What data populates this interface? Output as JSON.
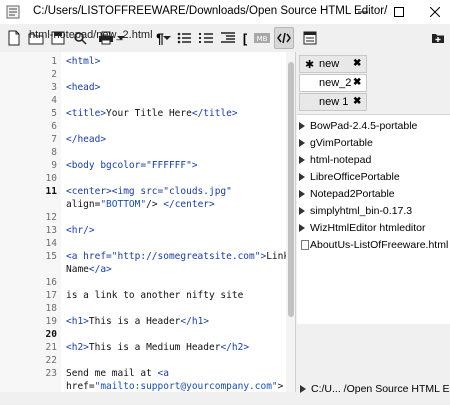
{
  "window": {
    "title": "C:/Users/LISTOFFREEWARE/Downloads/Open Source HTML Editor/"
  },
  "toolbar": {
    "tab_tooltip": "html-notepad/new_2.html",
    "icons": [
      "new-document-icon",
      "open-folder-icon",
      "save-icon",
      "find-icon",
      "print-icon",
      "dropdown-icon",
      "paragraph-icon",
      "dropdown-icon",
      "bullet-list-icon",
      "numbered-list-icon",
      "indent-icon",
      "outdent-icon",
      "bracket-icon",
      "highlight-icon",
      "code-view-icon",
      "layout-icon",
      "add-folder-icon"
    ]
  },
  "editor": {
    "lines": [
      {
        "n": "1",
        "text": "<html>"
      },
      {
        "n": "2",
        "text": ""
      },
      {
        "n": "3",
        "text": "<head>"
      },
      {
        "n": "4",
        "text": ""
      },
      {
        "n": "5",
        "text": "<title>Your Title Here</title>"
      },
      {
        "n": "6",
        "text": ""
      },
      {
        "n": "7",
        "text": "</head>"
      },
      {
        "n": "8",
        "text": ""
      },
      {
        "n": "9",
        "text": "<body bgcolor=\"FFFFFF\">"
      },
      {
        "n": "10",
        "text": ""
      },
      {
        "n": "11",
        "text": "<center><img src=\"clouds.jpg\""
      },
      {
        "n": "",
        "text": "align=\"BOTTOM\"/> </center>"
      },
      {
        "n": "12",
        "text": ""
      },
      {
        "n": "13",
        "text": "<hr/>"
      },
      {
        "n": "14",
        "text": ""
      },
      {
        "n": "15",
        "text": "<a href=\"http://somegreatsite.com\">Link"
      },
      {
        "n": "",
        "text": "Name</a>"
      },
      {
        "n": "16",
        "text": ""
      },
      {
        "n": "17",
        "text": "is a link to another nifty site"
      },
      {
        "n": "18",
        "text": ""
      },
      {
        "n": "19",
        "text": "<h1>This is a Header</h1>"
      },
      {
        "n": "20",
        "text": ""
      },
      {
        "n": "21",
        "text": "<h2>This is a Medium Header</h2>"
      },
      {
        "n": "22",
        "text": ""
      },
      {
        "n": "23",
        "text": "Send me mail at <a"
      },
      {
        "n": "",
        "text": "href=\"mailto:support@yourcompany.com\">"
      }
    ]
  },
  "documents": [
    {
      "label": "new",
      "modified": true,
      "active": false
    },
    {
      "label": "new_2",
      "modified": false,
      "active": true
    },
    {
      "label": "new 1",
      "modified": false,
      "active": false
    }
  ],
  "tree": {
    "folders": [
      "BowPad-2.4.5-portable",
      "gVimPortable",
      "html-notepad",
      "LibreOfficePortable",
      "Notepad2Portable",
      "simplyhtml_bin-0.17.3",
      "WizHtmlEditor htmleditor"
    ],
    "files": [
      "AboutUs-ListOfFreeware.html"
    ]
  },
  "status": {
    "path": "C:/U... /Open Source HTML Editor"
  }
}
